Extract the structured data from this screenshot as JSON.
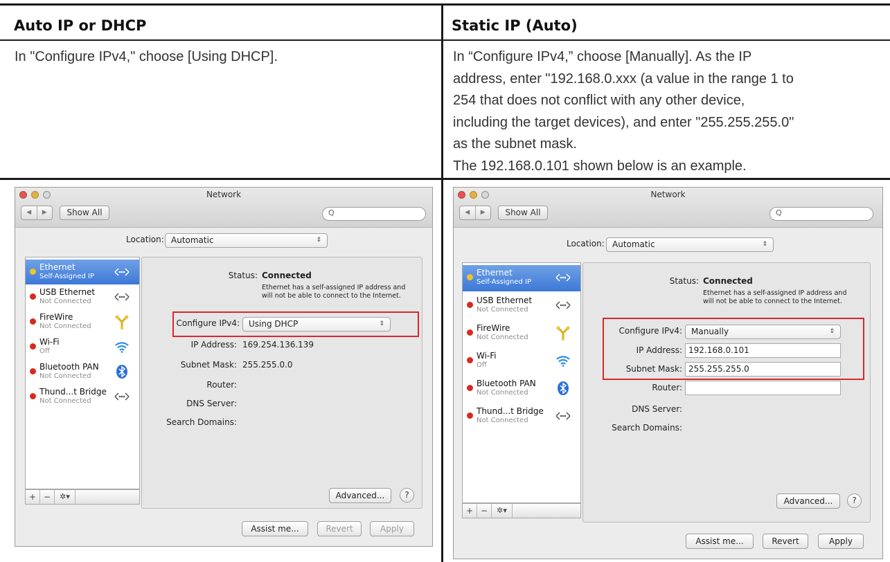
{
  "doc": {
    "left_header": "Auto IP or DHCP",
    "right_header": "Static IP (Auto)",
    "left_text": "In \"Configure IPv4,\" choose [Using DHCP].",
    "right_text_lines": [
      "In “Configure IPv4,” choose [Manually]. As the IP",
      "address, enter \"192.168.0.xxx (a value in the range 1 to",
      "254 that does not conflict with any other device,",
      "including the target devices), and enter \"255.255.255.0\"",
      "as the subnet mask.",
      "The 192.168.0.101 shown below is an example."
    ]
  },
  "common": {
    "window_title": "Network",
    "nav_back": "◀",
    "nav_forward": "▶",
    "show_all": "Show All",
    "search_glyph": "Q",
    "location_label": "Location:",
    "location_value": "Automatic",
    "popup_arrows": "⇕",
    "status_label": "Status:",
    "status_value": "Connected",
    "status_note_1": "Ethernet has a self-assigned IP address and",
    "status_note_2": "will not be able to connect to the Internet.",
    "configure_label": "Configure IPv4:",
    "ip_label": "IP Address:",
    "subnet_label": "Subnet Mask:",
    "router_label": "Router:",
    "dns_label": "DNS Server:",
    "search_domains_label": "Search Domains:",
    "advanced": "Advanced...",
    "help": "?",
    "assist": "Assist me...",
    "revert": "Revert",
    "apply": "Apply",
    "tool_add": "+",
    "tool_remove": "−",
    "tool_gear": "✲▾",
    "services": [
      {
        "name": "Ethernet",
        "sub": "Self-Assigned IP",
        "status": "yellow",
        "icon": "ethernet-arrows-icon"
      },
      {
        "name": "USB Ethernet",
        "sub": "Not Connected",
        "status": "red",
        "icon": "ethernet-arrows-icon"
      },
      {
        "name": "FireWire",
        "sub": "Not Connected",
        "status": "red",
        "icon": "firewire-icon"
      },
      {
        "name": "Wi-Fi",
        "sub": "Off",
        "status": "red",
        "icon": "wifi-icon"
      },
      {
        "name": "Bluetooth PAN",
        "sub": "Not Connected",
        "status": "red",
        "icon": "bluetooth-icon"
      },
      {
        "name": "Thund...t Bridge",
        "sub": "Not Connected",
        "status": "red",
        "icon": "ethernet-arrows-icon"
      }
    ]
  },
  "dhcp": {
    "configure_value": "Using DHCP",
    "ip_value": "169.254.136.139",
    "subnet_value": "255.255.0.0"
  },
  "static": {
    "configure_value": "Manually",
    "ip_value": "192.168.0.101",
    "subnet_value": "255.255.255.0"
  },
  "colors": {
    "highlight_box": "#d9262c",
    "selection": "#3d78d8"
  }
}
